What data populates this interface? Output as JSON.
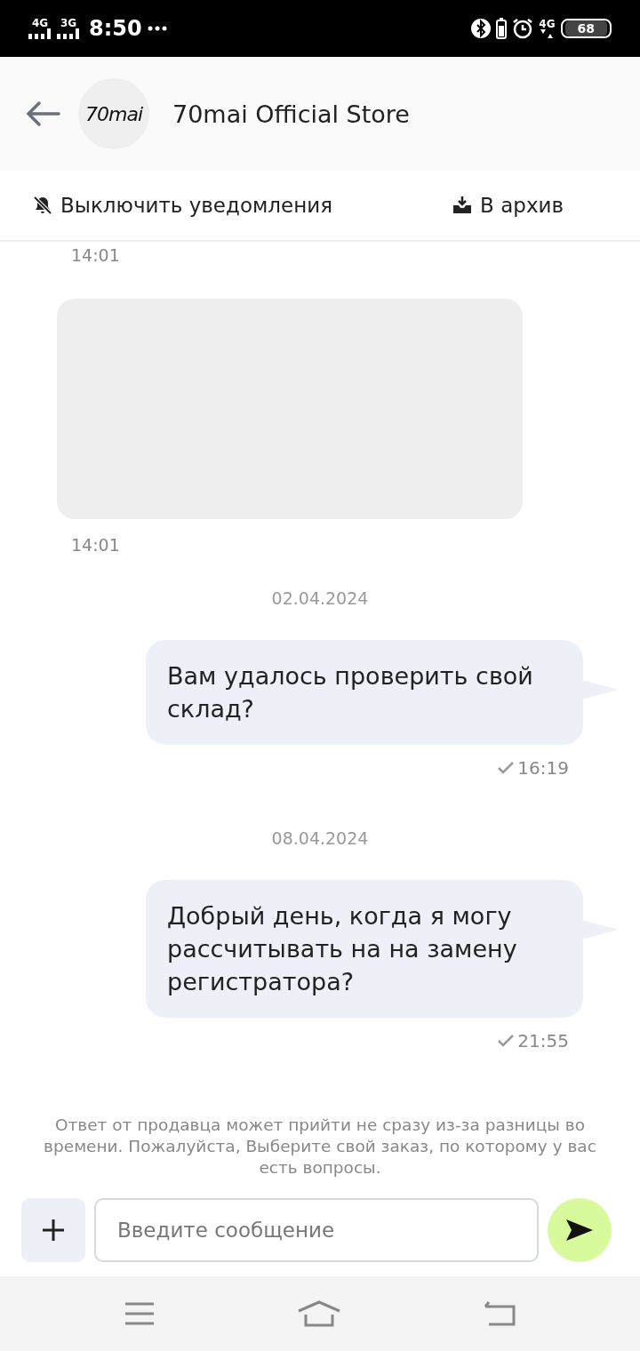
{
  "status_bar": {
    "network_1": "4G",
    "network_2": "3G",
    "time": "8:50",
    "data": "4G",
    "battery": "68"
  },
  "header": {
    "logo": "70mai",
    "title": "70mai Official Store"
  },
  "actions": [
    {
      "kind": "mute",
      "label": "Выключить уведомления"
    },
    {
      "kind": "archive",
      "label": "В архив"
    }
  ],
  "messages": [
    {
      "kind": "time",
      "time": "14:01"
    },
    {
      "kind": "image"
    },
    {
      "kind": "time",
      "time": "14:01"
    },
    {
      "kind": "date",
      "date": "02.04.2024"
    },
    {
      "kind": "outgoing",
      "text": "Вам удалось проверить свой склад?",
      "time": "16:19",
      "delivered": true
    },
    {
      "kind": "date",
      "date": "08.04.2024"
    },
    {
      "kind": "outgoing",
      "text": "Добрый день, когда я могу рассчитывать на на замену регистратора?",
      "time": "21:55",
      "delivered": true
    }
  ],
  "notice": "Ответ от продавца может прийти не сразу из-за разницы во времени. Пожалуйста, Выберите свой заказ, по которому у вас есть вопросы.",
  "composer": {
    "placeholder": "Введите сообщение"
  }
}
